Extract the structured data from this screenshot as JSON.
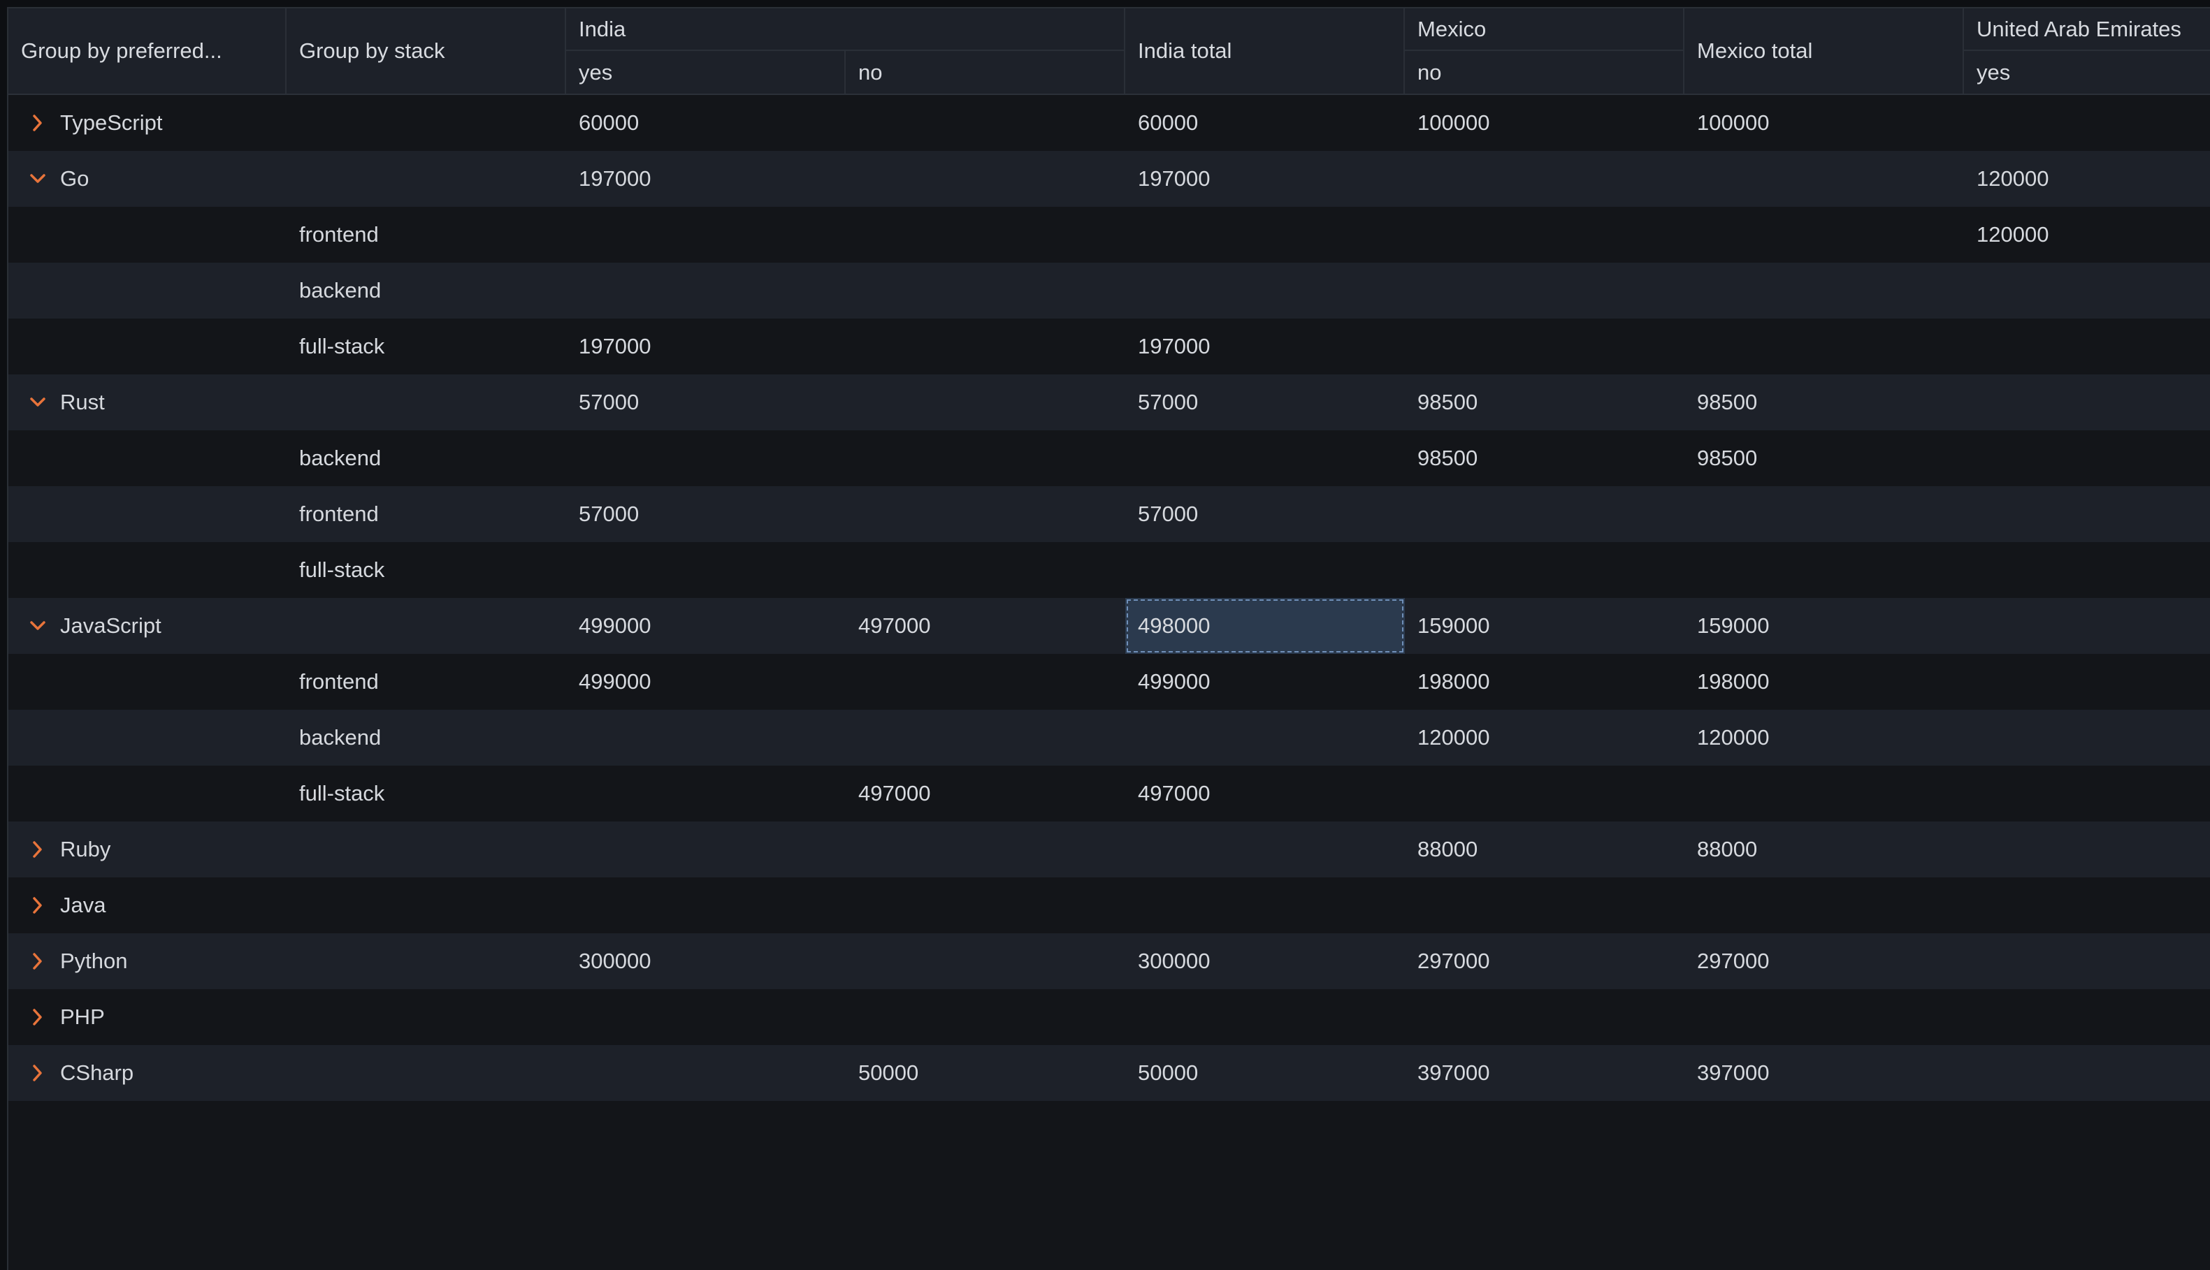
{
  "columns": {
    "group_preferred": "Group by preferred...",
    "group_stack": "Group by stack",
    "india": "India",
    "india_yes": "yes",
    "india_no": "no",
    "india_total": "India total",
    "mexico": "Mexico",
    "mexico_no": "no",
    "mexico_total": "Mexico total",
    "uae": "United Arab Emirates",
    "uae_yes": "yes"
  },
  "colors": {
    "accent_chevron": "#e8743b",
    "selection": "#2b3a4e"
  },
  "rows": [
    {
      "kind": "group",
      "expanded": false,
      "icon": "chevron-right-icon",
      "label": "TypeScript",
      "india_yes": "60000",
      "india_no": "",
      "india_total": "60000",
      "mexico_no": "100000",
      "mexico_total": "100000",
      "uae_yes": ""
    },
    {
      "kind": "group",
      "expanded": true,
      "icon": "chevron-down-icon",
      "label": "Go",
      "india_yes": "197000",
      "india_no": "",
      "india_total": "197000",
      "mexico_no": "",
      "mexico_total": "",
      "uae_yes": "120000"
    },
    {
      "kind": "child",
      "label": "frontend",
      "india_yes": "",
      "india_no": "",
      "india_total": "",
      "mexico_no": "",
      "mexico_total": "",
      "uae_yes": "120000"
    },
    {
      "kind": "child",
      "label": "backend",
      "india_yes": "",
      "india_no": "",
      "india_total": "",
      "mexico_no": "",
      "mexico_total": "",
      "uae_yes": ""
    },
    {
      "kind": "child",
      "label": "full-stack",
      "india_yes": "197000",
      "india_no": "",
      "india_total": "197000",
      "mexico_no": "",
      "mexico_total": "",
      "uae_yes": ""
    },
    {
      "kind": "group",
      "expanded": true,
      "icon": "chevron-down-icon",
      "label": "Rust",
      "india_yes": "57000",
      "india_no": "",
      "india_total": "57000",
      "mexico_no": "98500",
      "mexico_total": "98500",
      "uae_yes": ""
    },
    {
      "kind": "child",
      "label": "backend",
      "india_yes": "",
      "india_no": "",
      "india_total": "",
      "mexico_no": "98500",
      "mexico_total": "98500",
      "uae_yes": ""
    },
    {
      "kind": "child",
      "label": "frontend",
      "india_yes": "57000",
      "india_no": "",
      "india_total": "57000",
      "mexico_no": "",
      "mexico_total": "",
      "uae_yes": ""
    },
    {
      "kind": "child",
      "label": "full-stack",
      "india_yes": "",
      "india_no": "",
      "india_total": "",
      "mexico_no": "",
      "mexico_total": "",
      "uae_yes": ""
    },
    {
      "kind": "group",
      "expanded": true,
      "icon": "chevron-down-icon",
      "label": "JavaScript",
      "india_yes": "499000",
      "india_no": "497000",
      "india_total": "498000",
      "mexico_no": "159000",
      "mexico_total": "159000",
      "uae_yes": "",
      "selected": "india_total"
    },
    {
      "kind": "child",
      "label": "frontend",
      "india_yes": "499000",
      "india_no": "",
      "india_total": "499000",
      "mexico_no": "198000",
      "mexico_total": "198000",
      "uae_yes": ""
    },
    {
      "kind": "child",
      "label": "backend",
      "india_yes": "",
      "india_no": "",
      "india_total": "",
      "mexico_no": "120000",
      "mexico_total": "120000",
      "uae_yes": ""
    },
    {
      "kind": "child",
      "label": "full-stack",
      "india_yes": "",
      "india_no": "497000",
      "india_total": "497000",
      "mexico_no": "",
      "mexico_total": "",
      "uae_yes": ""
    },
    {
      "kind": "group",
      "expanded": false,
      "icon": "chevron-right-icon",
      "label": "Ruby",
      "india_yes": "",
      "india_no": "",
      "india_total": "",
      "mexico_no": "88000",
      "mexico_total": "88000",
      "uae_yes": ""
    },
    {
      "kind": "group",
      "expanded": false,
      "icon": "chevron-right-icon",
      "label": "Java",
      "india_yes": "",
      "india_no": "",
      "india_total": "",
      "mexico_no": "",
      "mexico_total": "",
      "uae_yes": ""
    },
    {
      "kind": "group",
      "expanded": false,
      "icon": "chevron-right-icon",
      "label": "Python",
      "india_yes": "300000",
      "india_no": "",
      "india_total": "300000",
      "mexico_no": "297000",
      "mexico_total": "297000",
      "uae_yes": ""
    },
    {
      "kind": "group",
      "expanded": false,
      "icon": "chevron-right-icon",
      "label": "PHP",
      "india_yes": "",
      "india_no": "",
      "india_total": "",
      "mexico_no": "",
      "mexico_total": "",
      "uae_yes": ""
    },
    {
      "kind": "group",
      "expanded": false,
      "icon": "chevron-right-icon",
      "label": "CSharp",
      "india_yes": "",
      "india_no": "50000",
      "india_total": "50000",
      "mexico_no": "397000",
      "mexico_total": "397000",
      "uae_yes": ""
    }
  ]
}
